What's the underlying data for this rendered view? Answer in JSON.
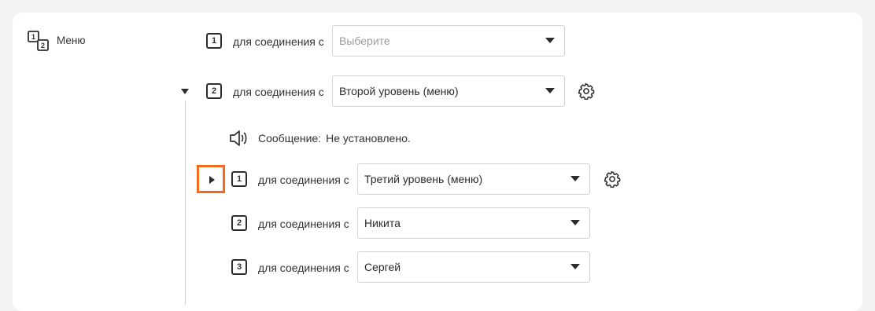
{
  "menu": {
    "label": "Меню"
  },
  "rows": [
    {
      "number": "1",
      "label": "для соединения с",
      "value": "Выберите",
      "placeholder": true
    },
    {
      "number": "2",
      "label": "для соединения с",
      "value": "Второй уровень (меню)",
      "placeholder": false
    }
  ],
  "submenu": {
    "message_label": "Сообщение:",
    "message_value": "Не установлено.",
    "rows": [
      {
        "number": "1",
        "label": "для соединения с",
        "value": "Третий уровень (меню)"
      },
      {
        "number": "2",
        "label": "для соединения с",
        "value": "Никита"
      },
      {
        "number": "3",
        "label": "для соединения с",
        "value": "Сергей"
      }
    ]
  },
  "icons": {
    "menu": "numbered-list-icon",
    "gear": "gear-icon",
    "speaker": "speaker-icon",
    "expand": "chevron-right-icon",
    "collapse": "chevron-down-icon",
    "dropdown": "caret-down-icon"
  },
  "colors": {
    "highlight": "#f26a1b",
    "background": "#f1f2f1",
    "card": "#ffffff"
  }
}
